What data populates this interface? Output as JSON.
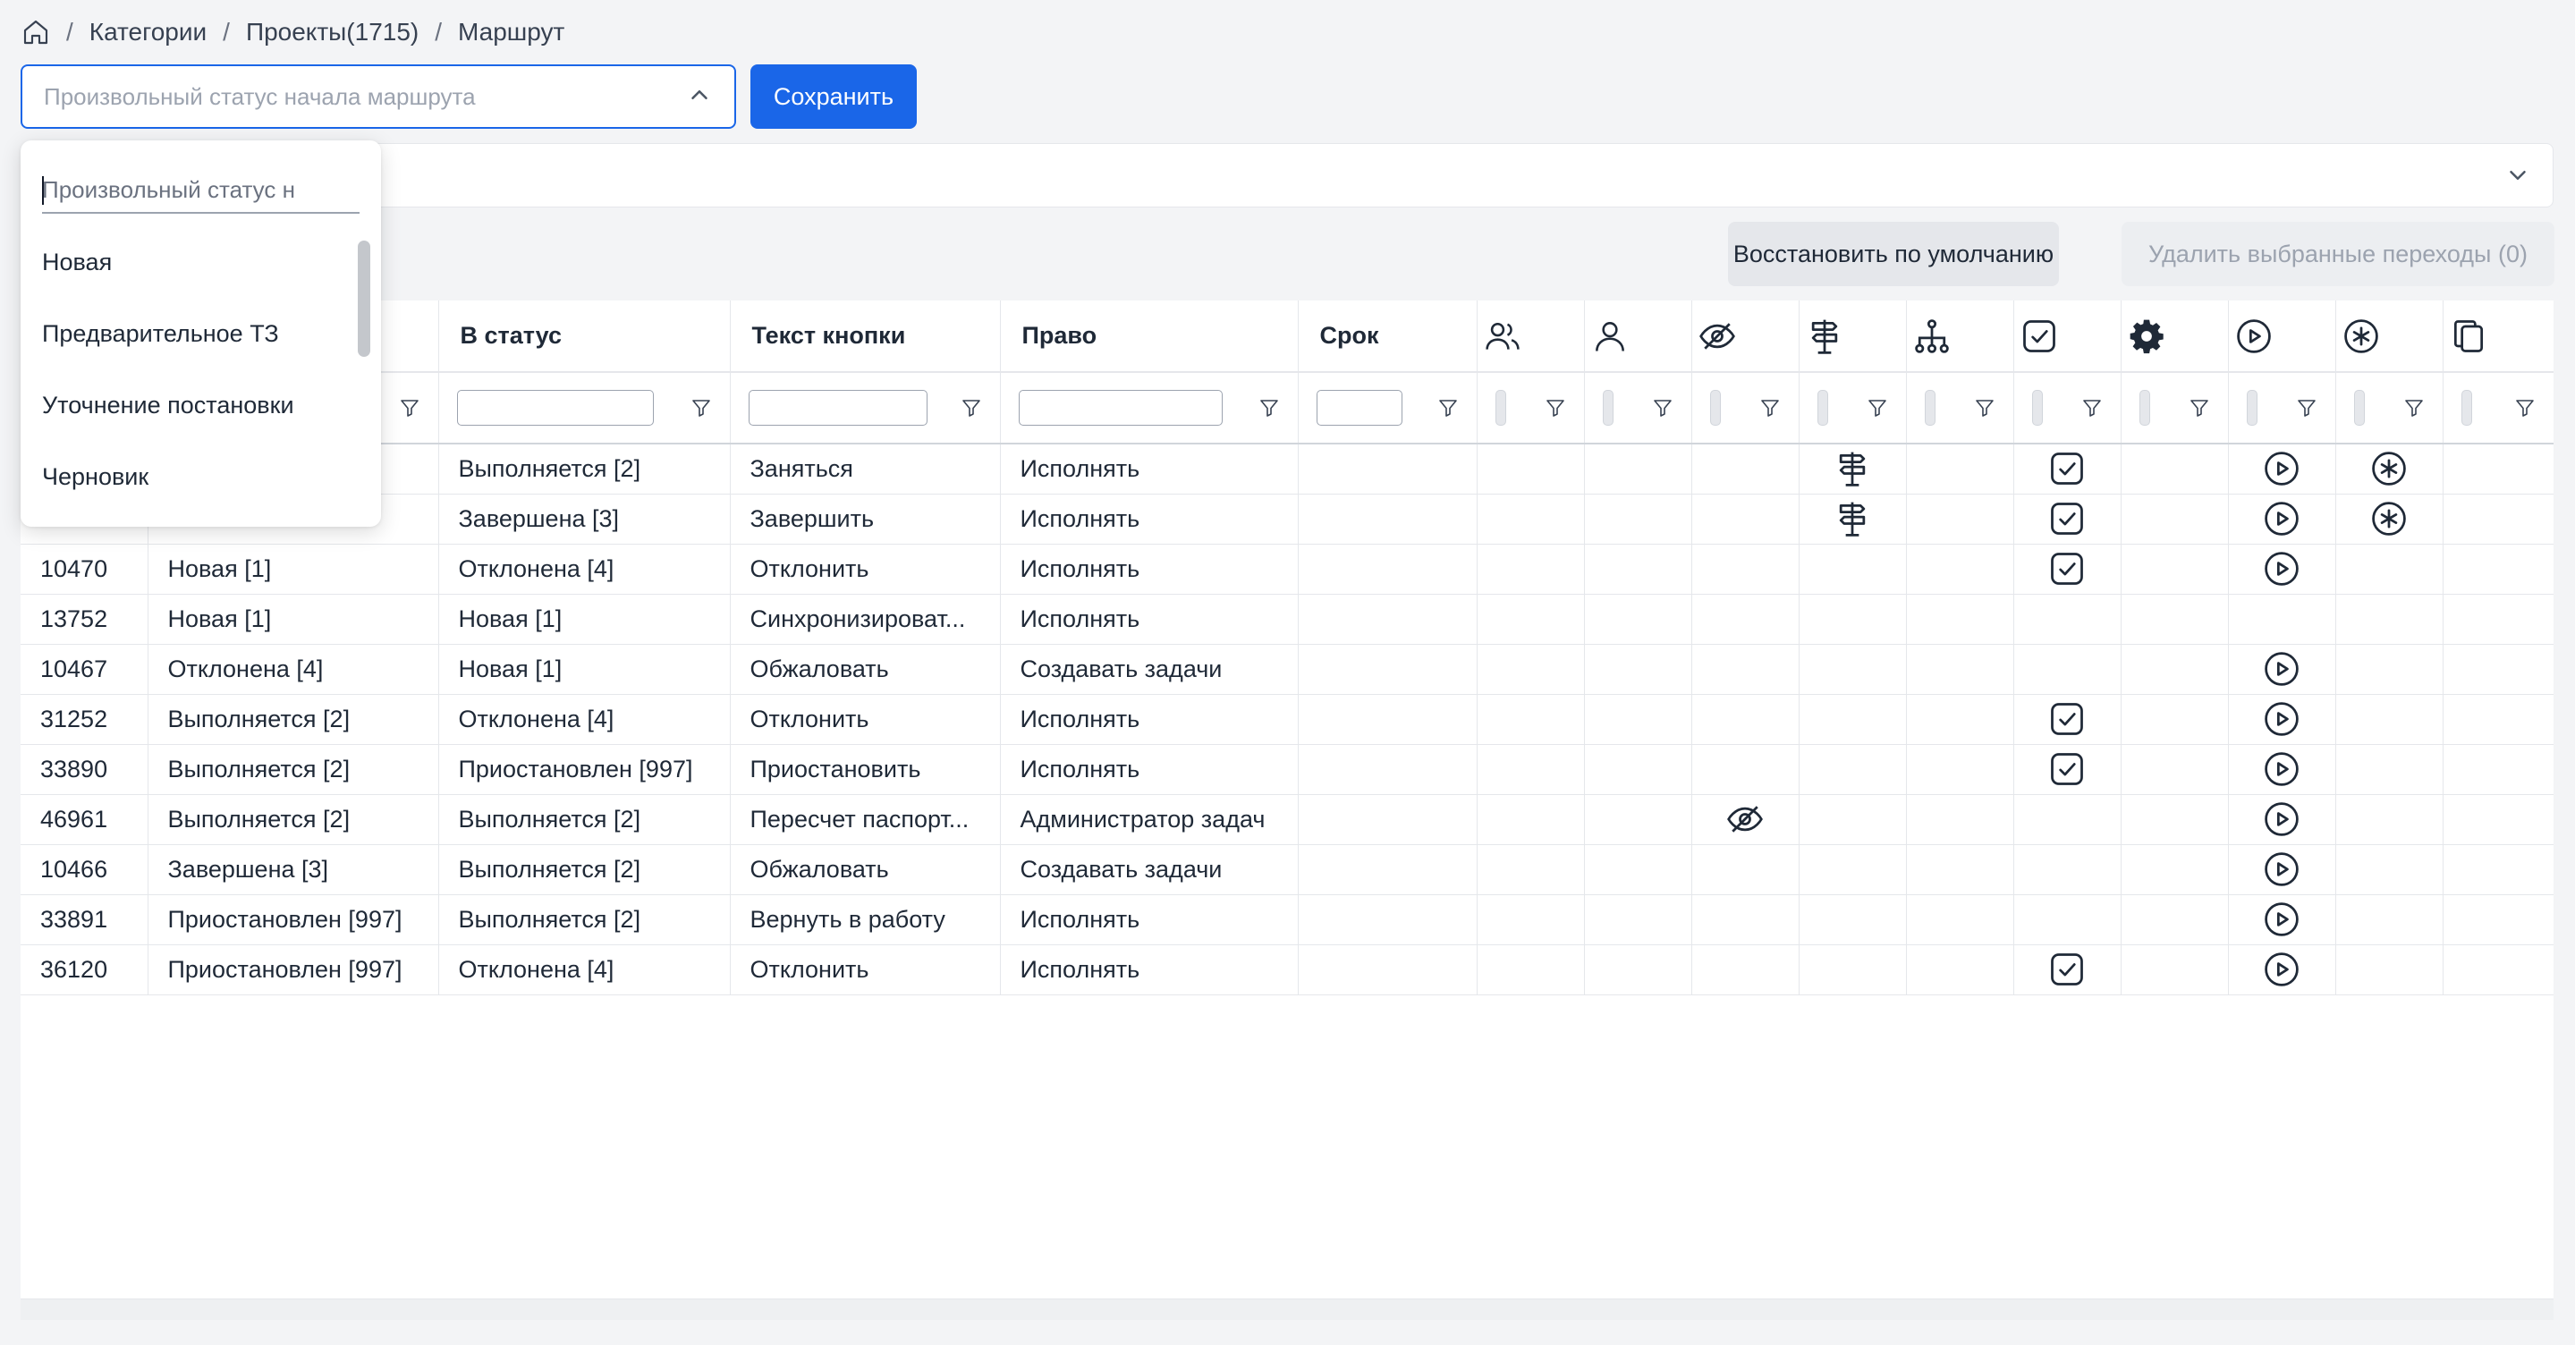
{
  "breadcrumb": {
    "home_icon": "home-icon",
    "separator": "/",
    "items": [
      "Категории",
      "Проекты(1715)",
      "Маршрут"
    ]
  },
  "toolbar": {
    "select_placeholder": "Произвольный статус начала маршрута",
    "save_label": "Сохранить"
  },
  "actions": {
    "restore_label": "Восстановить по умолчанию",
    "delete_label": "Удалить выбранные переходы (0)"
  },
  "dropdown": {
    "search_placeholder": "Произвольный статус н",
    "options": [
      "Новая",
      "Предварительное ТЗ",
      "Уточнение постановки",
      "Черновик"
    ]
  },
  "table": {
    "columns": [
      "В статус",
      "Текст кнопки",
      "Право",
      "Срок"
    ],
    "icon_columns": [
      "users-icon",
      "user-icon",
      "eye-off-icon",
      "signpost-icon",
      "hierarchy-icon",
      "check-square-icon",
      "gear-icon",
      "play-circle-icon",
      "asterisk-circle-icon",
      "copy-icon"
    ],
    "rows": [
      {
        "id": "",
        "from": "",
        "to": "Выполняется [2]",
        "button": "Заняться",
        "right": "Исполнять",
        "term": "",
        "icons": [
          "signpost",
          "check",
          "play",
          "asterisk"
        ]
      },
      {
        "id": "",
        "from": "",
        "to": "Завершена [3]",
        "button": "Завершить",
        "right": "Исполнять",
        "term": "",
        "icons": [
          "signpost",
          "check",
          "play",
          "asterisk"
        ]
      },
      {
        "id": "10470",
        "from": "Новая [1]",
        "to": "Отклонена [4]",
        "button": "Отклонить",
        "right": "Исполнять",
        "term": "",
        "icons": [
          "check",
          "play"
        ]
      },
      {
        "id": "13752",
        "from": "Новая [1]",
        "to": "Новая [1]",
        "button": "Синхронизироват...",
        "right": "Исполнять",
        "term": "",
        "icons": []
      },
      {
        "id": "10467",
        "from": "Отклонена [4]",
        "to": "Новая [1]",
        "button": "Обжаловать",
        "right": "Создавать задачи",
        "term": "",
        "icons": [
          "play"
        ]
      },
      {
        "id": "31252",
        "from": "Выполняется [2]",
        "to": "Отклонена [4]",
        "button": "Отклонить",
        "right": "Исполнять",
        "term": "",
        "icons": [
          "check",
          "play"
        ]
      },
      {
        "id": "33890",
        "from": "Выполняется [2]",
        "to": "Приостановлен [997]",
        "button": "Приостановить",
        "right": "Исполнять",
        "term": "",
        "icons": [
          "check",
          "play"
        ]
      },
      {
        "id": "46961",
        "from": "Выполняется [2]",
        "to": "Выполняется [2]",
        "button": "Пересчет паспорт...",
        "right": "Администратор задач",
        "term": "",
        "icons": [
          "eye",
          "play"
        ]
      },
      {
        "id": "10466",
        "from": "Завершена [3]",
        "to": "Выполняется [2]",
        "button": "Обжаловать",
        "right": "Создавать задачи",
        "term": "",
        "icons": [
          "play"
        ]
      },
      {
        "id": "33891",
        "from": "Приостановлен [997]",
        "to": "Выполняется [2]",
        "button": "Вернуть в работу",
        "right": "Исполнять",
        "term": "",
        "icons": [
          "play"
        ]
      },
      {
        "id": "36120",
        "from": "Приостановлен [997]",
        "to": "Отклонена [4]",
        "button": "Отклонить",
        "right": "Исполнять",
        "term": "",
        "icons": [
          "check",
          "play"
        ]
      }
    ]
  },
  "colors": {
    "accent": "#1a66e8",
    "border": "#e5e7eb",
    "background": "#f3f4f6"
  }
}
